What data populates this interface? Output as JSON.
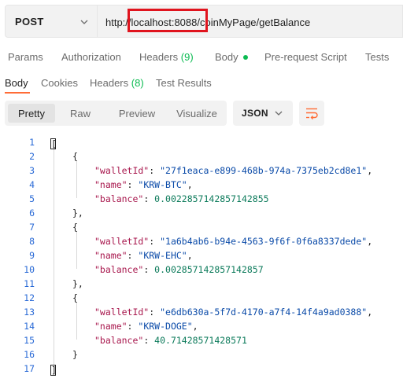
{
  "request": {
    "method": "POST",
    "url_prefix": "http://localhost",
    "url_port": ":8088",
    "url_suffix": "/coinMyPage/getBalance"
  },
  "request_tabs": [
    {
      "label": "Params"
    },
    {
      "label": "Authorization"
    },
    {
      "label": "Headers",
      "count": "(9)"
    },
    {
      "label": "Body",
      "has_dot": true
    },
    {
      "label": "Pre-request Script"
    },
    {
      "label": "Tests"
    }
  ],
  "response_tabs": [
    {
      "label": "Body",
      "active": true
    },
    {
      "label": "Cookies"
    },
    {
      "label": "Headers",
      "count": "(8)"
    },
    {
      "label": "Test Results"
    }
  ],
  "view_modes": [
    {
      "label": "Pretty",
      "active": true
    },
    {
      "label": "Raw"
    },
    {
      "label": "Preview"
    },
    {
      "label": "Visualize"
    }
  ],
  "format_select": {
    "value": "JSON"
  },
  "colors": {
    "accent": "#ff6c37",
    "count_green": "#0cbb52",
    "highlight_red": "#e0141e",
    "key_color": "#a8174d",
    "string_color": "#0a4aa8",
    "number_color": "#0b7a5a",
    "line_number_color": "#2a6ad6"
  },
  "icons": {
    "method_dropdown": "chevron-down-icon",
    "format_dropdown": "chevron-down-icon",
    "wrap": "wrap-lines-icon"
  },
  "code_lines": [
    {
      "n": "1",
      "tokens": [
        {
          "t": "p",
          "v": "["
        }
      ],
      "indent": 0,
      "cursor": true
    },
    {
      "n": "2",
      "tokens": [
        {
          "t": "p",
          "v": "{"
        }
      ],
      "indent": 1
    },
    {
      "n": "3",
      "tokens": [
        {
          "t": "k",
          "v": "\"walletId\""
        },
        {
          "t": "p",
          "v": ": "
        },
        {
          "t": "s",
          "v": "\"27f1eaca-e899-468b-974a-7375eb2cd8e1\""
        },
        {
          "t": "p",
          "v": ","
        }
      ],
      "indent": 2
    },
    {
      "n": "4",
      "tokens": [
        {
          "t": "k",
          "v": "\"name\""
        },
        {
          "t": "p",
          "v": ": "
        },
        {
          "t": "s",
          "v": "\"KRW-BTC\""
        },
        {
          "t": "p",
          "v": ","
        }
      ],
      "indent": 2
    },
    {
      "n": "5",
      "tokens": [
        {
          "t": "k",
          "v": "\"balance\""
        },
        {
          "t": "p",
          "v": ": "
        },
        {
          "t": "n",
          "v": "0.0022857142857142855"
        }
      ],
      "indent": 2
    },
    {
      "n": "6",
      "tokens": [
        {
          "t": "p",
          "v": "},"
        }
      ],
      "indent": 1
    },
    {
      "n": "7",
      "tokens": [
        {
          "t": "p",
          "v": "{"
        }
      ],
      "indent": 1
    },
    {
      "n": "8",
      "tokens": [
        {
          "t": "k",
          "v": "\"walletId\""
        },
        {
          "t": "p",
          "v": ": "
        },
        {
          "t": "s",
          "v": "\"1a6b4ab6-b94e-4563-9f6f-0f6a8337dede\""
        },
        {
          "t": "p",
          "v": ","
        }
      ],
      "indent": 2
    },
    {
      "n": "9",
      "tokens": [
        {
          "t": "k",
          "v": "\"name\""
        },
        {
          "t": "p",
          "v": ": "
        },
        {
          "t": "s",
          "v": "\"KRW-EHC\""
        },
        {
          "t": "p",
          "v": ","
        }
      ],
      "indent": 2
    },
    {
      "n": "10",
      "tokens": [
        {
          "t": "k",
          "v": "\"balance\""
        },
        {
          "t": "p",
          "v": ": "
        },
        {
          "t": "n",
          "v": "0.002857142857142857"
        }
      ],
      "indent": 2
    },
    {
      "n": "11",
      "tokens": [
        {
          "t": "p",
          "v": "},"
        }
      ],
      "indent": 1
    },
    {
      "n": "12",
      "tokens": [
        {
          "t": "p",
          "v": "{"
        }
      ],
      "indent": 1
    },
    {
      "n": "13",
      "tokens": [
        {
          "t": "k",
          "v": "\"walletId\""
        },
        {
          "t": "p",
          "v": ": "
        },
        {
          "t": "s",
          "v": "\"e6db630a-5f7d-4170-a7f4-14f4a9ad0388\""
        },
        {
          "t": "p",
          "v": ","
        }
      ],
      "indent": 2
    },
    {
      "n": "14",
      "tokens": [
        {
          "t": "k",
          "v": "\"name\""
        },
        {
          "t": "p",
          "v": ": "
        },
        {
          "t": "s",
          "v": "\"KRW-DOGE\""
        },
        {
          "t": "p",
          "v": ","
        }
      ],
      "indent": 2
    },
    {
      "n": "15",
      "tokens": [
        {
          "t": "k",
          "v": "\"balance\""
        },
        {
          "t": "p",
          "v": ": "
        },
        {
          "t": "n",
          "v": "40.71428571428571"
        }
      ],
      "indent": 2
    },
    {
      "n": "16",
      "tokens": [
        {
          "t": "p",
          "v": "}"
        }
      ],
      "indent": 1
    },
    {
      "n": "17",
      "tokens": [
        {
          "t": "p",
          "v": "]"
        }
      ],
      "indent": 0,
      "cursor": true
    }
  ]
}
